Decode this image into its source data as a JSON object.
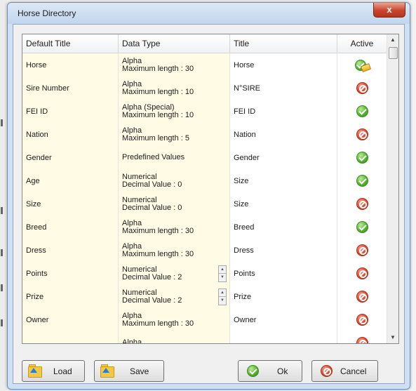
{
  "window": {
    "title": "Horse Directory",
    "close_glyph": "x"
  },
  "grid": {
    "columns": [
      "Default Title",
      "Data Type",
      "Title",
      "Active"
    ],
    "rows": [
      {
        "default_title": "Horse",
        "type_line1": "Alpha",
        "type_line2": "Maximum length : 30",
        "title": "Horse",
        "status": "active-edit",
        "spinner": false
      },
      {
        "default_title": "Sire Number",
        "type_line1": "Alpha",
        "type_line2": "Maximum length : 10",
        "title": "N°SIRE",
        "status": "inactive",
        "spinner": false
      },
      {
        "default_title": "FEI ID",
        "type_line1": "Alpha (Special)",
        "type_line2": "Maximum length : 10",
        "title": "FEI ID",
        "status": "active",
        "spinner": false
      },
      {
        "default_title": "Nation",
        "type_line1": "Alpha",
        "type_line2": "Maximum length : 5",
        "title": "Nation",
        "status": "inactive",
        "spinner": false
      },
      {
        "default_title": "Gender",
        "type_line1": "Predefined Values",
        "type_line2": "",
        "title": "Gender",
        "status": "active",
        "spinner": false
      },
      {
        "default_title": "Age",
        "type_line1": "Numerical",
        "type_line2": "Decimal Value : 0",
        "title": "Size",
        "status": "active",
        "spinner": false
      },
      {
        "default_title": "Size",
        "type_line1": "Numerical",
        "type_line2": "Decimal Value : 0",
        "title": "Size",
        "status": "inactive",
        "spinner": false
      },
      {
        "default_title": "Breed",
        "type_line1": "Alpha",
        "type_line2": "Maximum length : 30",
        "title": "Breed",
        "status": "active",
        "spinner": false
      },
      {
        "default_title": "Dress",
        "type_line1": "Alpha",
        "type_line2": "Maximum length : 30",
        "title": "Dress",
        "status": "inactive",
        "spinner": false
      },
      {
        "default_title": "Points",
        "type_line1": "Numerical",
        "type_line2": "Decimal Value : 2",
        "title": "Points",
        "status": "inactive",
        "spinner": true
      },
      {
        "default_title": "Prize",
        "type_line1": "Numerical",
        "type_line2": "Decimal Value : 2",
        "title": "Prize",
        "status": "inactive",
        "spinner": true
      },
      {
        "default_title": "Owner",
        "type_line1": "Alpha",
        "type_line2": "Maximum length : 30",
        "title": "Owner",
        "status": "inactive",
        "spinner": false
      },
      {
        "default_title": "",
        "type_line1": "Alpha",
        "type_line2": "",
        "title": "",
        "status": "inactive",
        "spinner": false
      }
    ]
  },
  "buttons": {
    "load": "Load",
    "save": "Save",
    "ok": "Ok",
    "cancel": "Cancel"
  },
  "colors": {
    "active": "#4caf2e",
    "inactive": "#d9462e",
    "cell_highlight": "#fffbe4"
  }
}
